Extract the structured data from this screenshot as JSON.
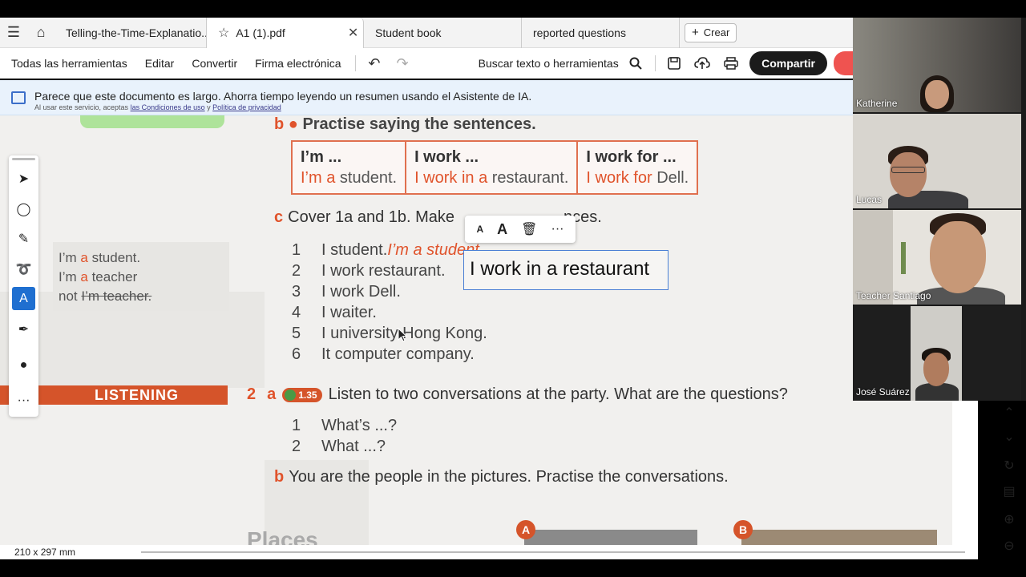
{
  "tabs": {
    "items": [
      {
        "label": "Telling-the-Time-Explanatio..."
      },
      {
        "label": "A1 (1).pdf"
      },
      {
        "label": "Student book"
      },
      {
        "label": "reported questions"
      }
    ],
    "new_label": "Crear"
  },
  "toolbar": {
    "all_tools": "Todas las herramientas",
    "edit": "Editar",
    "convert": "Convertir",
    "esign": "Firma electrónica",
    "search": "Buscar texto o herramientas",
    "share": "Compartir"
  },
  "banner": {
    "message": "Parece que este documento es largo. Ahorra tiempo leyendo un resumen usando el Asistente de IA.",
    "small_prefix": "Al usar este servicio, aceptas",
    "terms": "las Condiciones de uso",
    "and": "y",
    "privacy": "Política de privacidad"
  },
  "document": {
    "section_b_letter": "b",
    "section_b_text": "Practise saying the sentences.",
    "table": [
      {
        "head": "I’m ...",
        "orange": "I’m a",
        "rest": " student."
      },
      {
        "head": "I work ...",
        "orange": "I work in a",
        "rest": " restaurant."
      },
      {
        "head": "I work for ...",
        "orange": "I work for",
        "rest": " Dell."
      }
    ],
    "section_c_letter": "c",
    "section_c_text": "Cover 1a and 1b. Make",
    "section_c_tail": "nces.",
    "side_lines": [
      {
        "pre": "I’m ",
        "orange": "a",
        "post": " student."
      },
      {
        "pre": "I’m ",
        "orange": "a",
        "post": " teacher"
      },
      {
        "pre": "not ",
        "orange": "",
        "post": "I’m teacher."
      }
    ],
    "exercise_items": [
      {
        "num": "1",
        "text": "I student. ",
        "answer": "I’m a student."
      },
      {
        "num": "2",
        "text": "I work restaurant.",
        "answer": ""
      },
      {
        "num": "3",
        "text": "I work Dell.",
        "answer": ""
      },
      {
        "num": "4",
        "text": "I waiter.",
        "answer": ""
      },
      {
        "num": "5",
        "text": "I university Hong Kong.",
        "answer": ""
      },
      {
        "num": "6",
        "text": "It computer company.",
        "answer": ""
      }
    ],
    "textbox_value": "I work in a restaurant",
    "listening_label": "LISTENING",
    "ex2_num": "2",
    "ex2_letter": "a",
    "ex2_audio": "1.35",
    "ex2_text": "Listen to two conversations at the party. What are the questions?",
    "questions": [
      {
        "num": "1",
        "text": "What’s ...?"
      },
      {
        "num": "2",
        "text": "What ...?"
      }
    ],
    "section_b2_letter": "b",
    "section_b2_text": "You are the people in the pictures. Practise the conversations.",
    "places": "Places",
    "pic_a": "A",
    "pic_b": "B"
  },
  "status": {
    "page_size": "210 x 297 mm"
  },
  "participants": [
    {
      "name": "Katherine"
    },
    {
      "name": "Lucas"
    },
    {
      "name": "Teacher Santiago"
    },
    {
      "name": "José Suárez"
    }
  ],
  "colors": {
    "accent": "#e0532b",
    "selected_tool": "#1f6fd0",
    "share_button": "#1b1b1b"
  }
}
